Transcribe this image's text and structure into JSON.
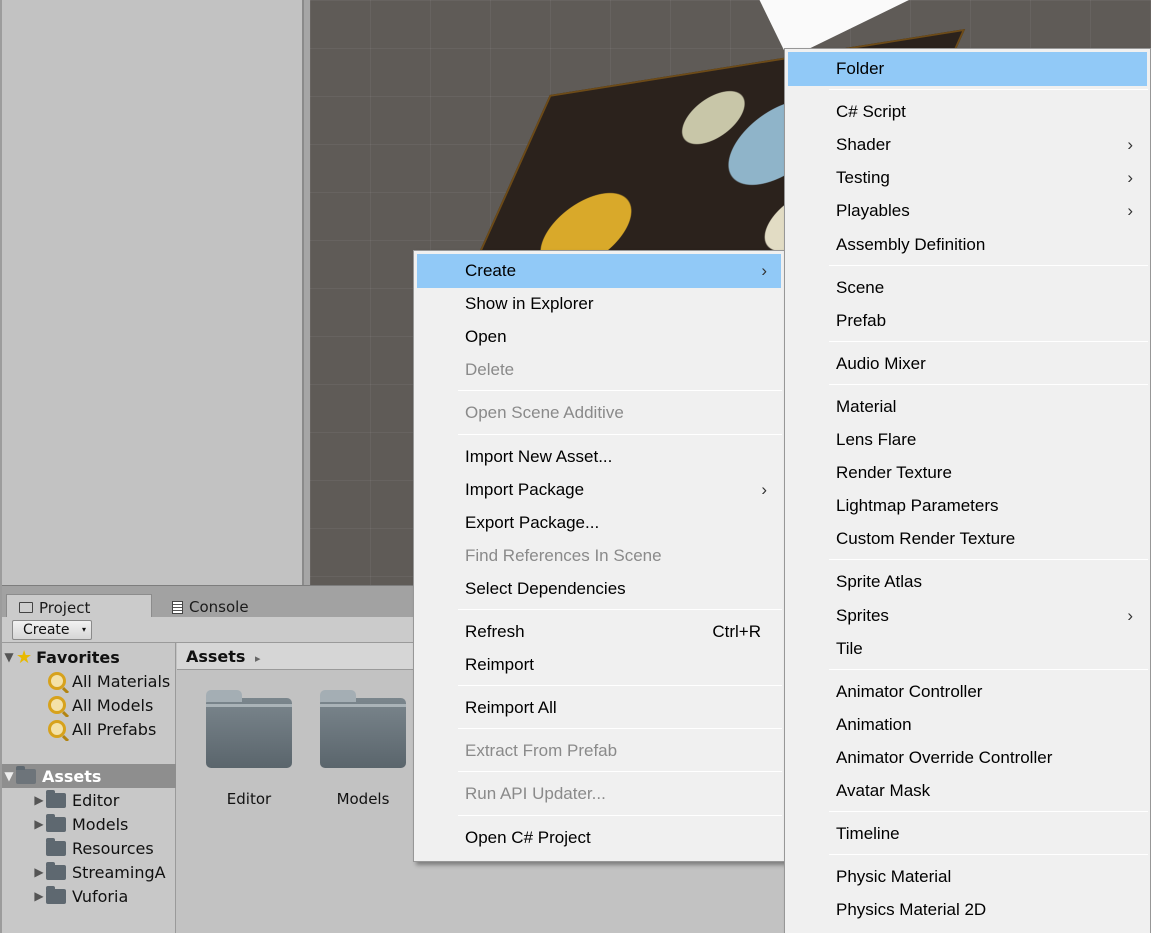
{
  "project_window": {
    "tabs": [
      {
        "label": "Project",
        "icon": "folder-icon"
      },
      {
        "label": "Console",
        "icon": "console-icon"
      }
    ],
    "toolbar": {
      "create_label": "Create",
      "create_caret": "▾"
    },
    "favorites": {
      "header": "Favorites",
      "items": [
        "All Materials",
        "All Models",
        "All Prefabs"
      ]
    },
    "assets_tree": {
      "header": "Assets",
      "items": [
        "Editor",
        "Models",
        "Resources",
        "StreamingA",
        "Vuforia"
      ]
    },
    "breadcrumb": {
      "label": "Assets",
      "chevron": "▸"
    },
    "asset_tiles": [
      "Editor",
      "Models"
    ]
  },
  "context_menu": {
    "items": [
      {
        "label": "Create",
        "submenu": true,
        "highlight": true
      },
      {
        "label": "Show in Explorer"
      },
      {
        "label": "Open"
      },
      {
        "label": "Delete",
        "disabled": true
      },
      {
        "separator": true
      },
      {
        "label": "Open Scene Additive",
        "disabled": true
      },
      {
        "separator": true
      },
      {
        "label": "Import New Asset..."
      },
      {
        "label": "Import Package",
        "submenu": true
      },
      {
        "label": "Export Package..."
      },
      {
        "label": "Find References In Scene",
        "disabled": true
      },
      {
        "label": "Select Dependencies"
      },
      {
        "separator": true
      },
      {
        "label": "Refresh",
        "shortcut": "Ctrl+R"
      },
      {
        "label": "Reimport"
      },
      {
        "separator": true
      },
      {
        "label": "Reimport All"
      },
      {
        "separator": true
      },
      {
        "label": "Extract From Prefab",
        "disabled": true
      },
      {
        "separator": true
      },
      {
        "label": "Run API Updater...",
        "disabled": true
      },
      {
        "separator": true
      },
      {
        "label": "Open C# Project"
      }
    ]
  },
  "create_submenu": {
    "items": [
      {
        "label": "Folder",
        "highlight": true
      },
      {
        "separator": true
      },
      {
        "label": "C# Script"
      },
      {
        "label": "Shader",
        "submenu": true
      },
      {
        "label": "Testing",
        "submenu": true
      },
      {
        "label": "Playables",
        "submenu": true
      },
      {
        "label": "Assembly Definition"
      },
      {
        "separator": true
      },
      {
        "label": "Scene"
      },
      {
        "label": "Prefab"
      },
      {
        "separator": true
      },
      {
        "label": "Audio Mixer"
      },
      {
        "separator": true
      },
      {
        "label": "Material"
      },
      {
        "label": "Lens Flare"
      },
      {
        "label": "Render Texture"
      },
      {
        "label": "Lightmap Parameters"
      },
      {
        "label": "Custom Render Texture"
      },
      {
        "separator": true
      },
      {
        "label": "Sprite Atlas"
      },
      {
        "label": "Sprites",
        "submenu": true
      },
      {
        "label": "Tile"
      },
      {
        "separator": true
      },
      {
        "label": "Animator Controller"
      },
      {
        "label": "Animation"
      },
      {
        "label": "Animator Override Controller"
      },
      {
        "label": "Avatar Mask"
      },
      {
        "separator": true
      },
      {
        "label": "Timeline"
      },
      {
        "separator": true
      },
      {
        "label": "Physic Material"
      },
      {
        "label": "Physics Material 2D"
      }
    ]
  },
  "glyphs": {
    "submenu_arrow": "›",
    "tree_arrow": "▶",
    "tree_arrow_open": "▼",
    "star": "★"
  },
  "colors": {
    "highlight": "#91c9f7",
    "disabled_text": "#8a8a8a",
    "selected_row": "#8e8e8e"
  }
}
